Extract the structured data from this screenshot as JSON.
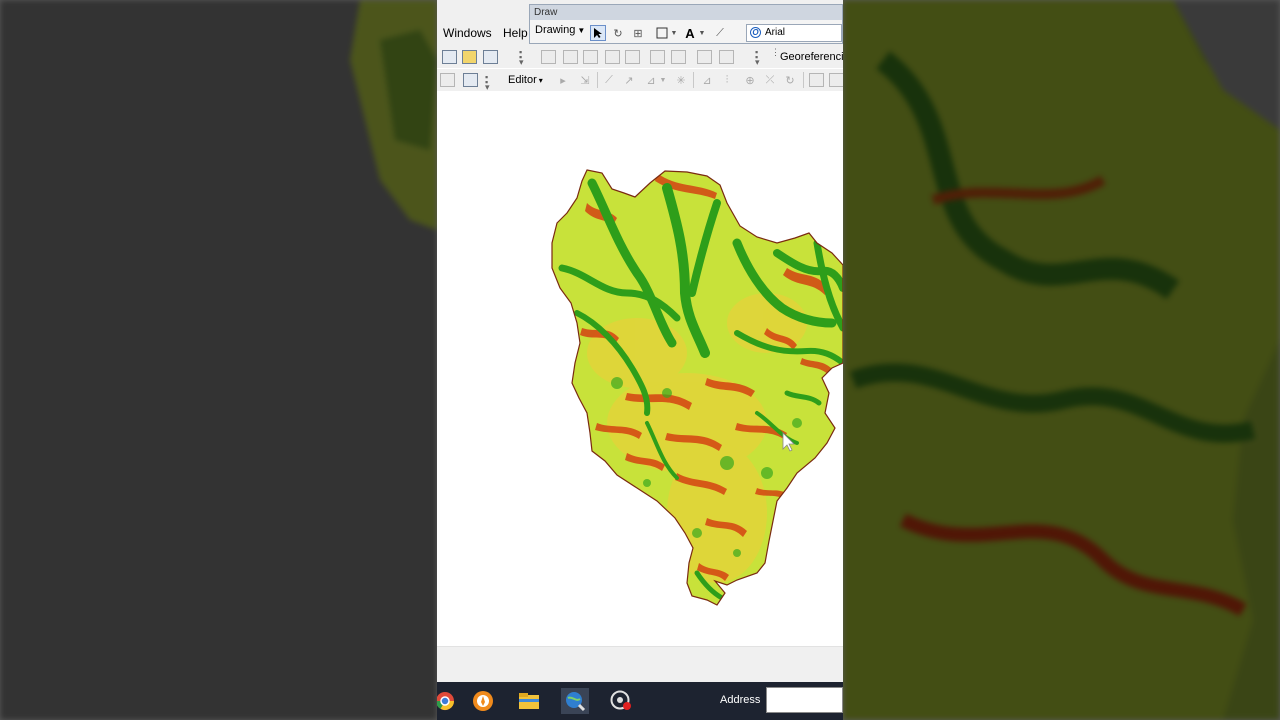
{
  "menu": {
    "windows_label": "Windows",
    "help_label": "Help"
  },
  "draw_toolbar": {
    "title": "Draw",
    "drawing_label": "Drawing",
    "font_name": "Arial",
    "font_icon_glyph": "O",
    "text_tool_glyph": "A"
  },
  "georef_toolbar": {
    "label": "Georeferenci"
  },
  "editor_toolbar": {
    "editor_label": "Editor"
  },
  "taskbar": {
    "address_label": "Address",
    "address_value": ""
  },
  "map": {
    "colors": {
      "low": "#2e9e1a",
      "mid": "#c8e23a",
      "high": "#d33a10"
    }
  }
}
